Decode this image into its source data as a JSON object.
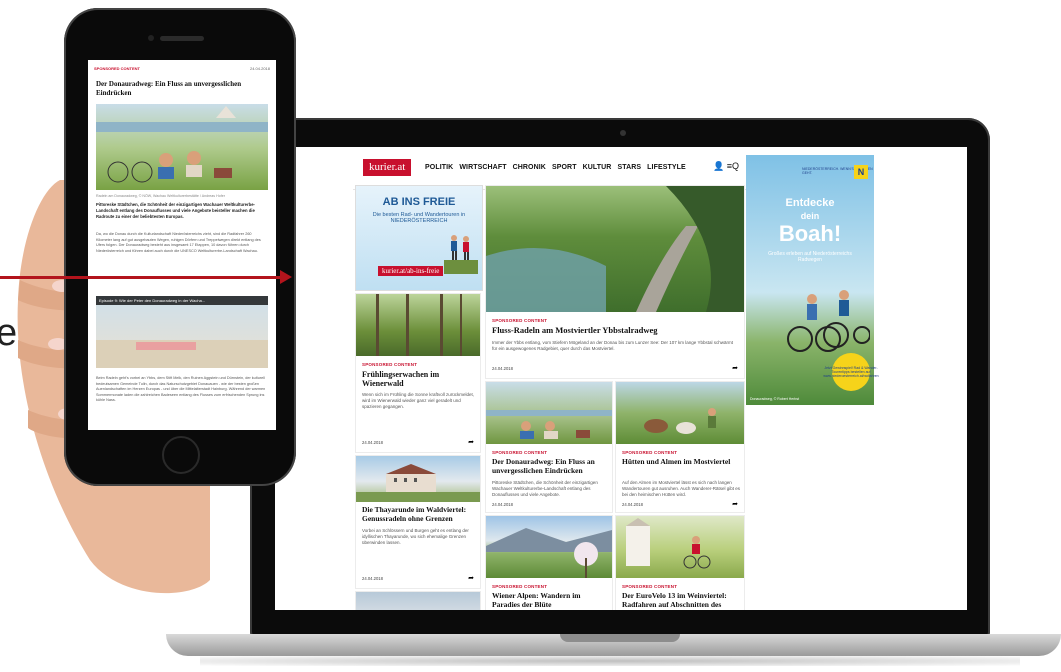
{
  "edge_text": "e",
  "laptop": {
    "site": {
      "logo": "kurier.at",
      "nav": [
        "POLITIK",
        "WIRTSCHAFT",
        "CHRONIK",
        "SPORT",
        "KULTUR",
        "STARS",
        "LIFESTYLE"
      ],
      "header_icons": "👤 ≡Q",
      "ad_left": {
        "headline": "AB INS FREIE",
        "sub": "Die besten Rad- und Wandertouren in NIEDERÖSTERREICH",
        "url": "kurier.at/ab-ins-freie"
      },
      "hero": {
        "tag": "SPONSORED CONTENT",
        "title": "Fluss-Radeln am Mostviertler Ybbstalradweg",
        "text": "Immer der Ybbs entlang, vom Stiefern Mögeland an der Donau bis zum Lunzer See: Der 107 km lange Ybbstal schwärmt für ein ausgewogenes Radgebiet, quer durch das Mostviertel.",
        "date": "24.04.2018"
      },
      "card_fruehling": {
        "tag": "SPONSORED CONTENT",
        "title": "Frühlingserwachen im Wienerwald",
        "text": "Wenn sich im Frühling die Sonne kraftvoll zurückmeldet, wird im Wienerwald wieder ganz viel geradelt und spazieren gegangen.",
        "date": "24.04.2018"
      },
      "card_thaya": {
        "tag": "SPONSORED CONTENT",
        "title": "Die Thayarunde im Waldviertel: Genussradeln ohne Grenzen",
        "text": "Vorbei an Schlössern und Burgen geht es entlang der idyllischen Thayarunde, wo sich ehemalige Grenzen überwinden lassen.",
        "date": "24.04.2018"
      },
      "card_donau": {
        "tag": "SPONSORED CONTENT",
        "title": "Der Donauradweg: Ein Fluss an unvergesslichen Eindrücken",
        "text": "Pittoreske Städtchen, die Schönheit der einzigartigen Wachauer Weltkulturerbe-Landschaft entlang des Donauflusses und viele Angebote.",
        "date": "24.04.2018"
      },
      "card_huetten": {
        "tag": "SPONSORED CONTENT",
        "title": "Hütten und Almen im Mostviertel",
        "text": "Auf den Almen im Mostviertel lässt es sich nach langen Wandertouren gut ausruhen. Auch Wanderer-Rätsel gibt es bei den heimischen Hütten wird.",
        "date": "24.04.2018"
      },
      "card_wiener": {
        "tag": "SPONSORED CONTENT",
        "title": "Wiener Alpen: Wandern im Paradies der Blüte"
      },
      "card_eurovelo": {
        "tag": "SPONSORED CONTENT",
        "title": "Der EuroVelo 13 im Weinviertel: Radfahren auf Abschnitten des"
      },
      "ad_right": {
        "brand": "NIEDERÖSTERREICH. WENN'S UM LEBEN GEHT.",
        "line1": "Entdecke",
        "line2": "dein",
        "line3": "Boah!",
        "sub": "Großes erleben auf Niederösterreichs Radwegen",
        "badge": "Jetzt Gewinnspiel! Rad & Wander-Tourentipps bestellen auf www.niederoesterreich.at/radfahren",
        "credit": "Donauradweg, © Robert Herbst"
      }
    }
  },
  "phone": {
    "tag": "SPONSORED CONTENT",
    "date": "24.04.2018",
    "title": "Der Donauradweg: Ein Fluss an unvergesslichen Eindrücken",
    "caption": "Radeln am Donauradweg, © NÖW, Wachau Weltkulturerbestätte / Andreas Hofer",
    "lead": "Pittoreske Städtchen, die Schönheit der einzigartigen Wachauer Weltkulturerbe-Landschaft entlang des Donauflusses und viele Angebote beisteller machen die Radroute zu einer der beliebtesten Europas.",
    "body": "Da, wo die Donau durch die Kulturlandschaft Niederösterreichs zieht, sind die Radfahrer 260 Kilometer lang auf gut ausgebauten Wegen, ruhigen Dörfern und Treppelwegen direkt entlang des Ufers folgen. Der Donauradweg besteht aus insgesamt 17 Etappen, 10 davon führen durch Niederösterreich und führen dabei auch durch die UNESCO Weltkulturerbe-Landschaft Wachau.",
    "video_title": "Episode 9: Wie der Peter den Donauradweg in der Wacha...",
    "body2": "Beim Radeln geht's vorbei an Ybbs, dem Stift Melk, den Ruinen Aggstein und Dürnstein, der kulturell bedeutsamen Gemeinde Tulln, durch das Naturschutzgebiet Donauauen - wie der besten großen Auenlandschaften im Herzen Europas - und über die Mittelalterstadt Hainburg. Während der warmen Sommermonate laden die zahlreichen Badeseen entlang des Flusses zum erfrischenden Sprung ins kühle Nass."
  },
  "colors": {
    "brand_red": "#c8102e",
    "arrow_red": "#b3141c",
    "ad_blue": "#1f5a96"
  }
}
